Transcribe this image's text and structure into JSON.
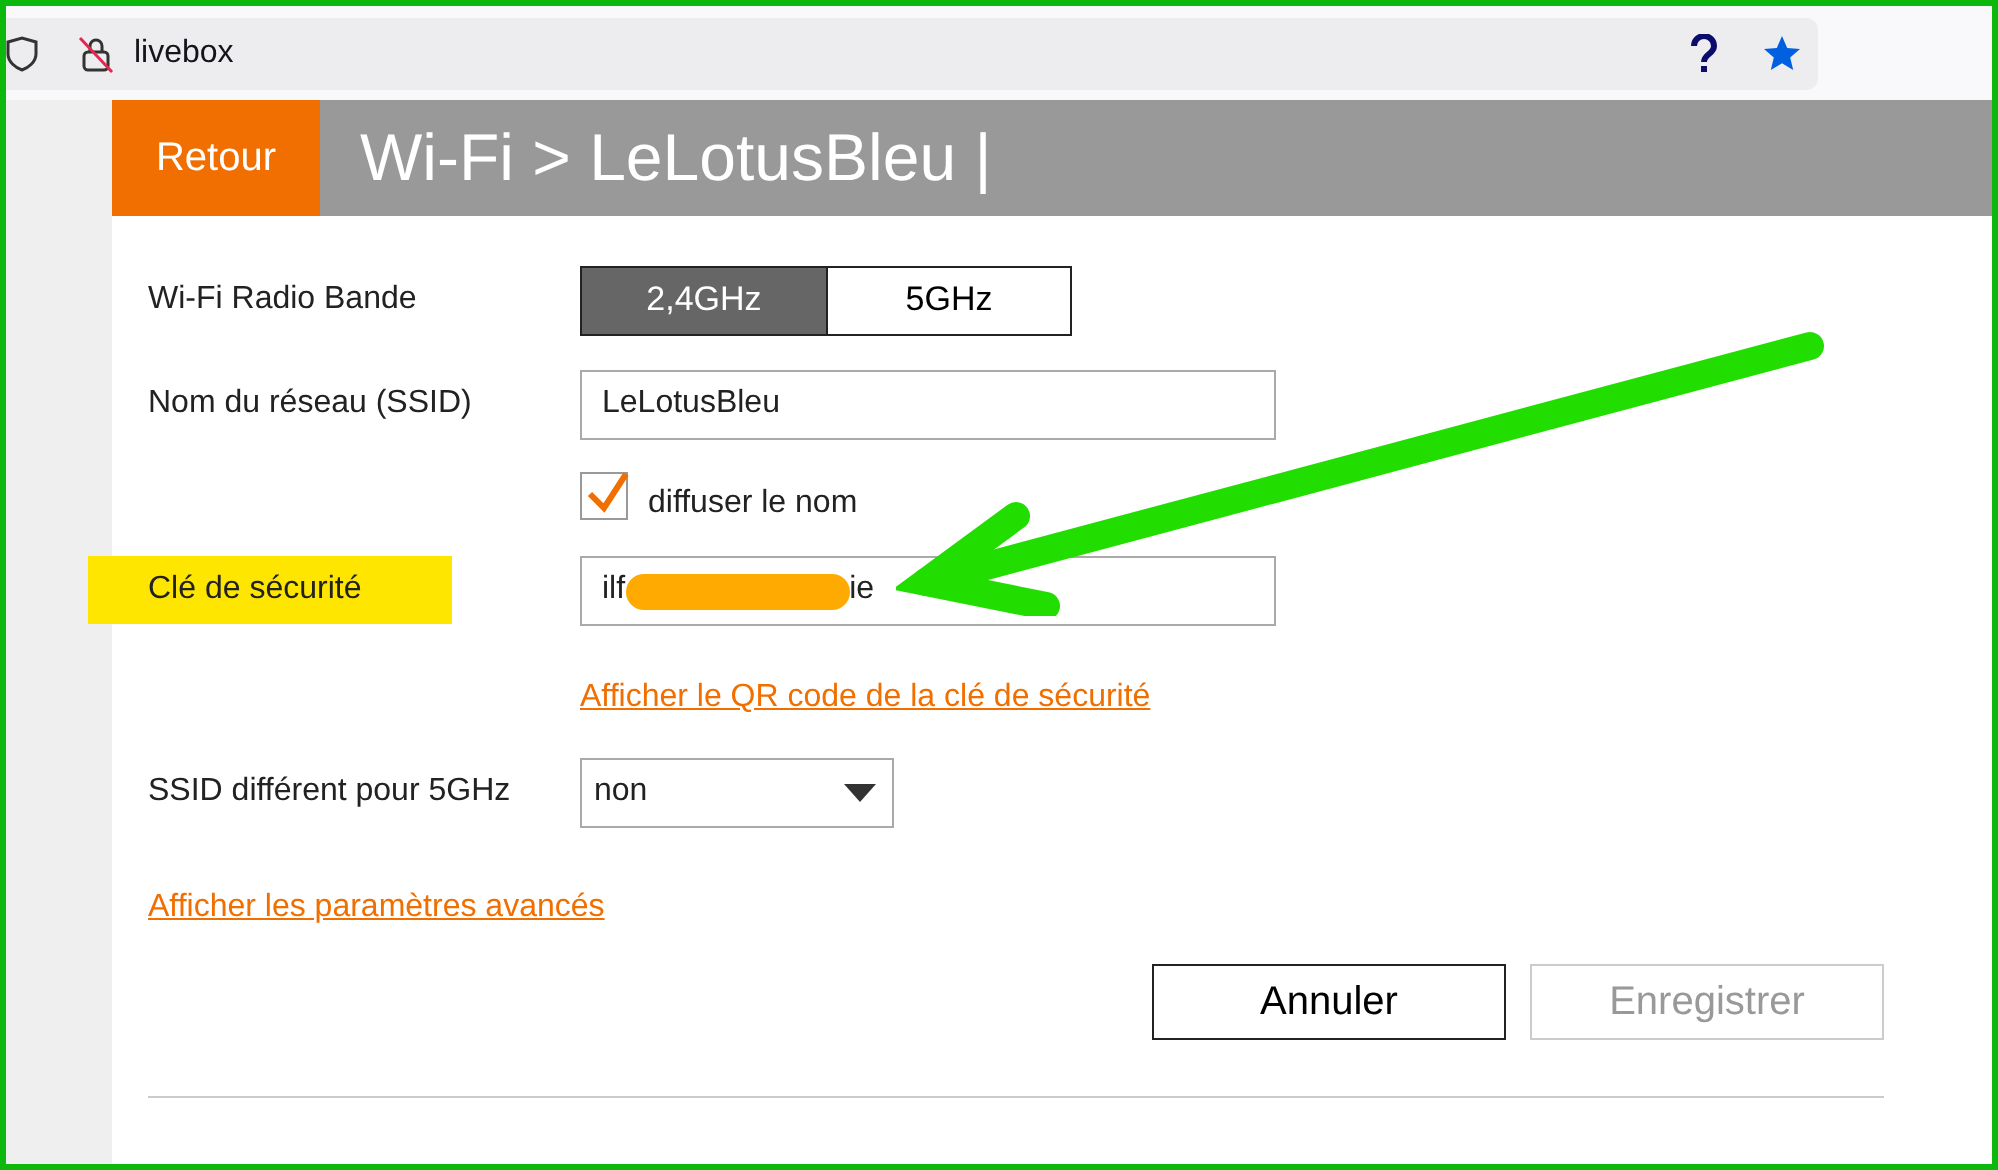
{
  "browser": {
    "address": "livebox"
  },
  "header": {
    "back": "Retour",
    "title": "Wi-Fi > LeLotusBleu |"
  },
  "form": [
    {
      "kind": "segmented",
      "label": "Wi-Fi Radio Bande",
      "highlighted": false,
      "options": [
        {
          "label": "2,4GHz",
          "selected": true
        },
        {
          "label": "5GHz",
          "selected": false
        }
      ]
    },
    {
      "kind": "text",
      "label": "Nom du réseau (SSID)",
      "highlighted": false,
      "value": "LeLotusBleu"
    },
    {
      "kind": "checkbox",
      "label": "diffuser le nom",
      "checked": true
    },
    {
      "kind": "redacted",
      "label": "Clé de sécurité",
      "highlighted": true,
      "value_start": "ilf",
      "value_end": "ie"
    },
    {
      "kind": "link",
      "label": "Afficher le QR code de la clé de sécurité"
    },
    {
      "kind": "select",
      "label": "SSID différent pour 5GHz",
      "highlighted": false,
      "value": "non"
    }
  ],
  "advanced_link": "Afficher les paramètres avancés",
  "buttons": [
    {
      "label": "Annuler",
      "disabled": false
    },
    {
      "label": "Enregistrer",
      "disabled": true
    }
  ]
}
